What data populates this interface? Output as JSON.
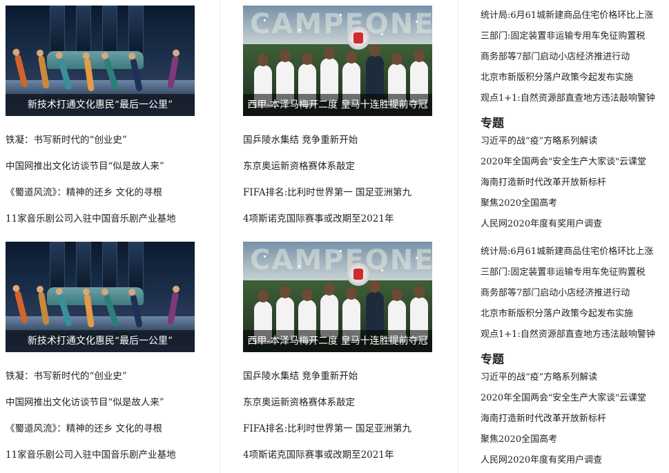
{
  "culture": {
    "photo_caption": "新技术打通文化惠民“最后一公里”",
    "links": [
      "铁凝：书写新时代的“创业史”",
      "中国网推出文化访谈节目“似是故人来”",
      "《蜀道风流》：精神的还乡 文化的寻根",
      "11家音乐剧公司入驻中国音乐剧产业基地"
    ]
  },
  "sports": {
    "photo_caption": "西甲-本泽马梅开二度 皇马十连胜提前夺冠",
    "banner_text": "CAMPEONES",
    "links": [
      "国乒陵水集结 竞争重新开始",
      "东京奥运新资格赛体系敲定",
      "FIFA排名:比利时世界第一 国足亚洲第九",
      "4项斯诺克国际赛事或改期至2021年"
    ]
  },
  "news": {
    "links": [
      "统计局:6月61城新建商品住宅价格环比上涨",
      "三部门:固定装置非运输专用车免征购置税",
      "商务部等7部门启动小店经济推进行动",
      "北京市新版积分落户政策今起发布实施",
      "观点1+1:自然资源部直查地方违法敲响警钟"
    ],
    "section_title": "专题",
    "topic_links": [
      "习近平的战“疫”方略系列解读",
      "2020年全国两会\"安全生产大家谈\"云课堂",
      "海南打造新时代改革开放新标杆",
      "聚焦2020全国高考",
      "人民网2020年度有奖用户调查"
    ]
  }
}
